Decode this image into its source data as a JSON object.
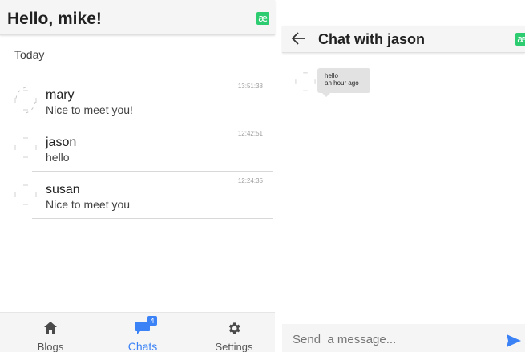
{
  "chat_list_screen": {
    "title": "Hello, mike!",
    "brand_glyph": "æ",
    "section_label": "Today",
    "chats": [
      {
        "name": "mary",
        "message": "Nice to meet you!",
        "time": "13:51:38"
      },
      {
        "name": "jason",
        "message": "hello",
        "time": "12:42:51"
      },
      {
        "name": "susan",
        "message": "Nice to meet you",
        "time": "12:24:35"
      }
    ],
    "bottom_nav": {
      "blogs": "Blogs",
      "chats": "Chats",
      "chats_badge": "4",
      "settings": "Settings",
      "active": "chats"
    }
  },
  "chat_screen": {
    "title": "Chat with jason",
    "brand_glyph": "æ",
    "messages": [
      {
        "text": "hello",
        "time": "an hour ago"
      }
    ],
    "composer": {
      "placeholder": "Send  a message..."
    }
  },
  "colors": {
    "accent": "#3b82f6",
    "brand": "#2ecc71",
    "header_bg": "#f5f5f5",
    "bubble_bg": "#e2e2e2"
  },
  "icons": {
    "back": "arrow-left-icon",
    "send": "send-icon",
    "blogs": "home-icon",
    "chats": "chat-bubble-icon",
    "settings": "gear-icon",
    "avatar": "avatar-placeholder-icon"
  }
}
